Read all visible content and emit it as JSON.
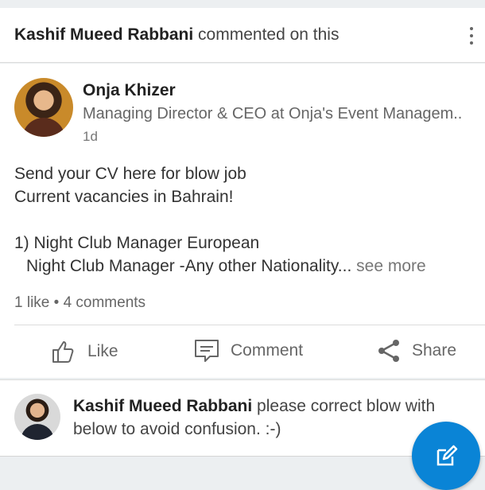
{
  "activity": {
    "actor": "Kashif Mueed Rabbani",
    "verb": "commented on this",
    "menu_icon": "more-vertical-icon"
  },
  "post": {
    "author": {
      "name": "Onja Khizer",
      "headline": "Managing Director & CEO at Onja's Event Managem..",
      "time": "1d"
    },
    "body_lines": [
      "Send your CV here for blow job",
      "Current vacancies in Bahrain!",
      "",
      "1) Night Club Manager European",
      "Night Club Manager  -Any other Nationality..."
    ],
    "see_more": "see more",
    "social_counts": "1 like • 4 comments",
    "actions": [
      {
        "label": "Like",
        "icon": "thumbs-up-icon"
      },
      {
        "label": "Comment",
        "icon": "comment-icon"
      },
      {
        "label": "Share",
        "icon": "share-icon"
      }
    ]
  },
  "comment": {
    "author": "Kashif Mueed Rabbani",
    "text": "please correct blow with below to avoid confusion. :-)"
  },
  "fab": {
    "icon": "compose-icon",
    "color": "#0a84d6"
  }
}
